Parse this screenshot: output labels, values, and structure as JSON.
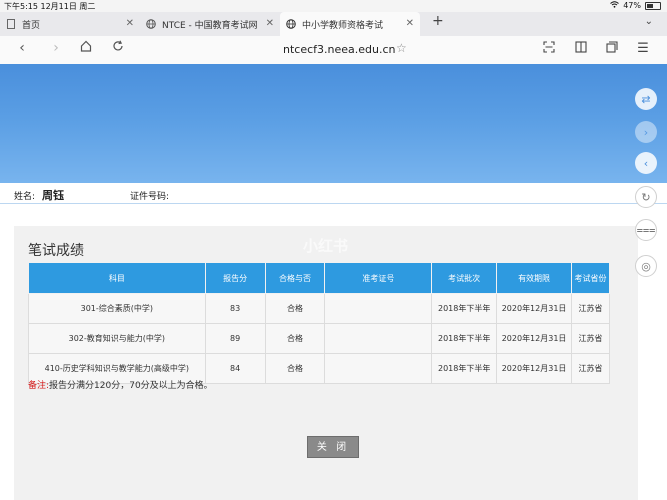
{
  "status_bar": {
    "time_date": "下午5:15  12月11日 周二",
    "wifi": "wifi-icon",
    "battery_text": "47%"
  },
  "tabs": [
    {
      "title": "首页",
      "icon": "page-icon",
      "active": false
    },
    {
      "title": "NTCE - 中国教育考试网",
      "icon": "globe-icon",
      "active": false
    },
    {
      "title": "中小学教师资格考试",
      "icon": "globe-icon",
      "active": true
    }
  ],
  "browser": {
    "url": "ntcecf3.neea.edu.cn"
  },
  "candidate": {
    "name_label": "姓名:",
    "name_value": "周钰",
    "id_label": "证件号码:"
  },
  "scores": {
    "title": "笔试成绩",
    "columns": [
      "科目",
      "报告分",
      "合格与否",
      "准考证号",
      "考试批次",
      "有效期限",
      "考试省份"
    ],
    "rows": [
      [
        "301-综合素质(中学)",
        "83",
        "合格",
        "",
        "2018年下半年",
        "2020年12月31日",
        "江苏省"
      ],
      [
        "302-教育知识与能力(中学)",
        "89",
        "合格",
        "",
        "2018年下半年",
        "2020年12月31日",
        "江苏省"
      ],
      [
        "410-历史学科知识与教学能力(高级中学)",
        "84",
        "合格",
        "",
        "2018年下半年",
        "2020年12月31日",
        "江苏省"
      ]
    ],
    "note_label": "备注:",
    "note_text": "报告分满分120分，70分及以上为合格。",
    "close_label": "关 闭"
  },
  "watermark": "小红书"
}
